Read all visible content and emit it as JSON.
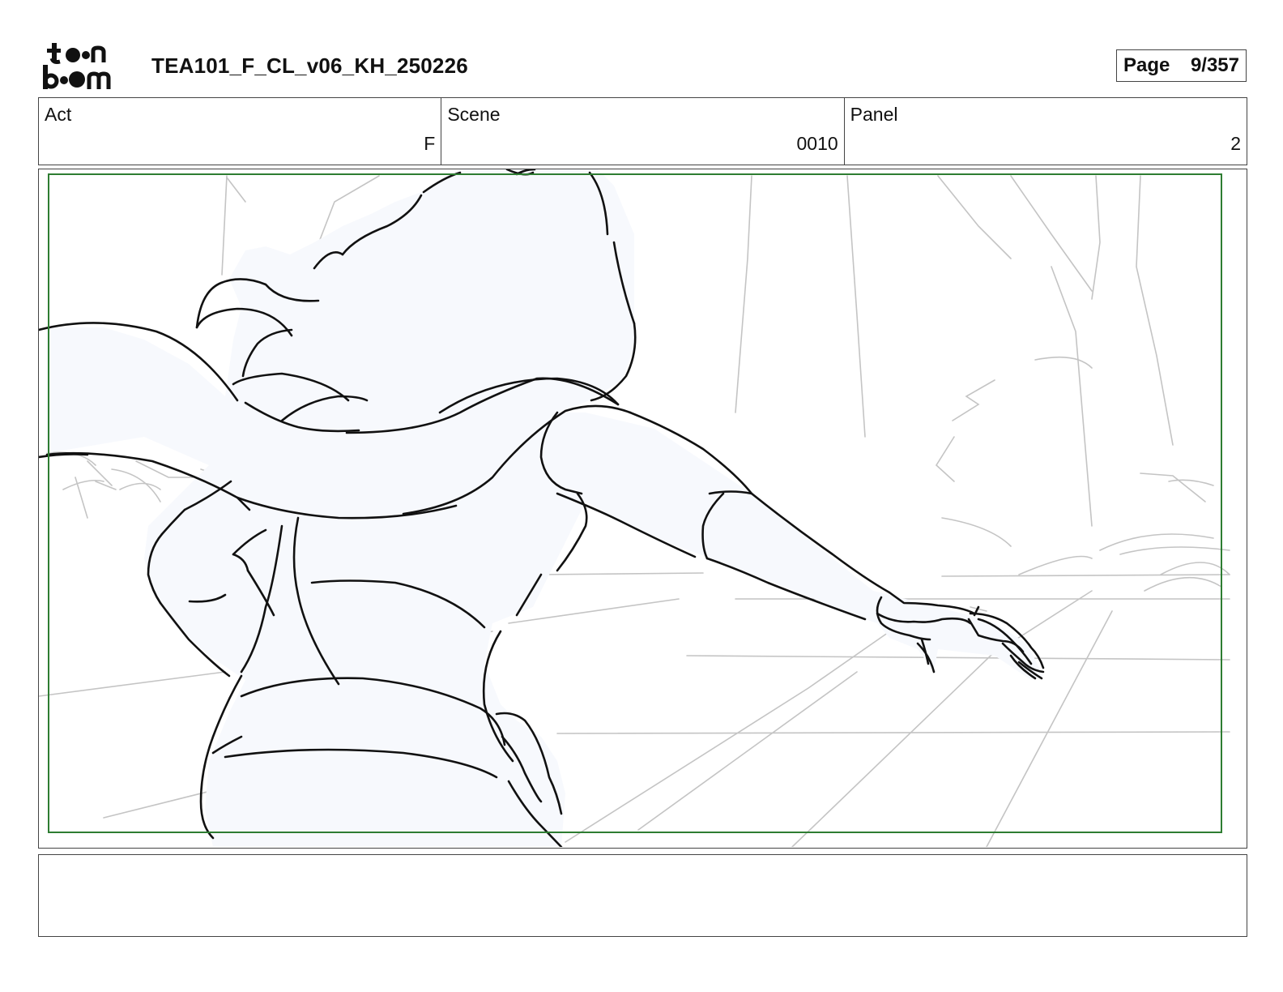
{
  "header": {
    "logo_icon": "toon-boom-logo",
    "logo_text": "toon boom",
    "document_title": "TEA101_F_CL_v06_KH_250226",
    "page_label": "Page",
    "page_value": "9/357"
  },
  "info": {
    "act_label": "Act",
    "act_value": "F",
    "scene_label": "Scene",
    "scene_value": "0010",
    "panel_label": "Panel",
    "panel_value": "2"
  },
  "panel": {
    "image_icon": "storyboard-sketch",
    "safe_frame_color": "#2e7d32",
    "character_fill": "#f7f9fd",
    "line_color": "#111111",
    "background_line_color": "#c4c4c4"
  },
  "notes": {
    "text": ""
  }
}
